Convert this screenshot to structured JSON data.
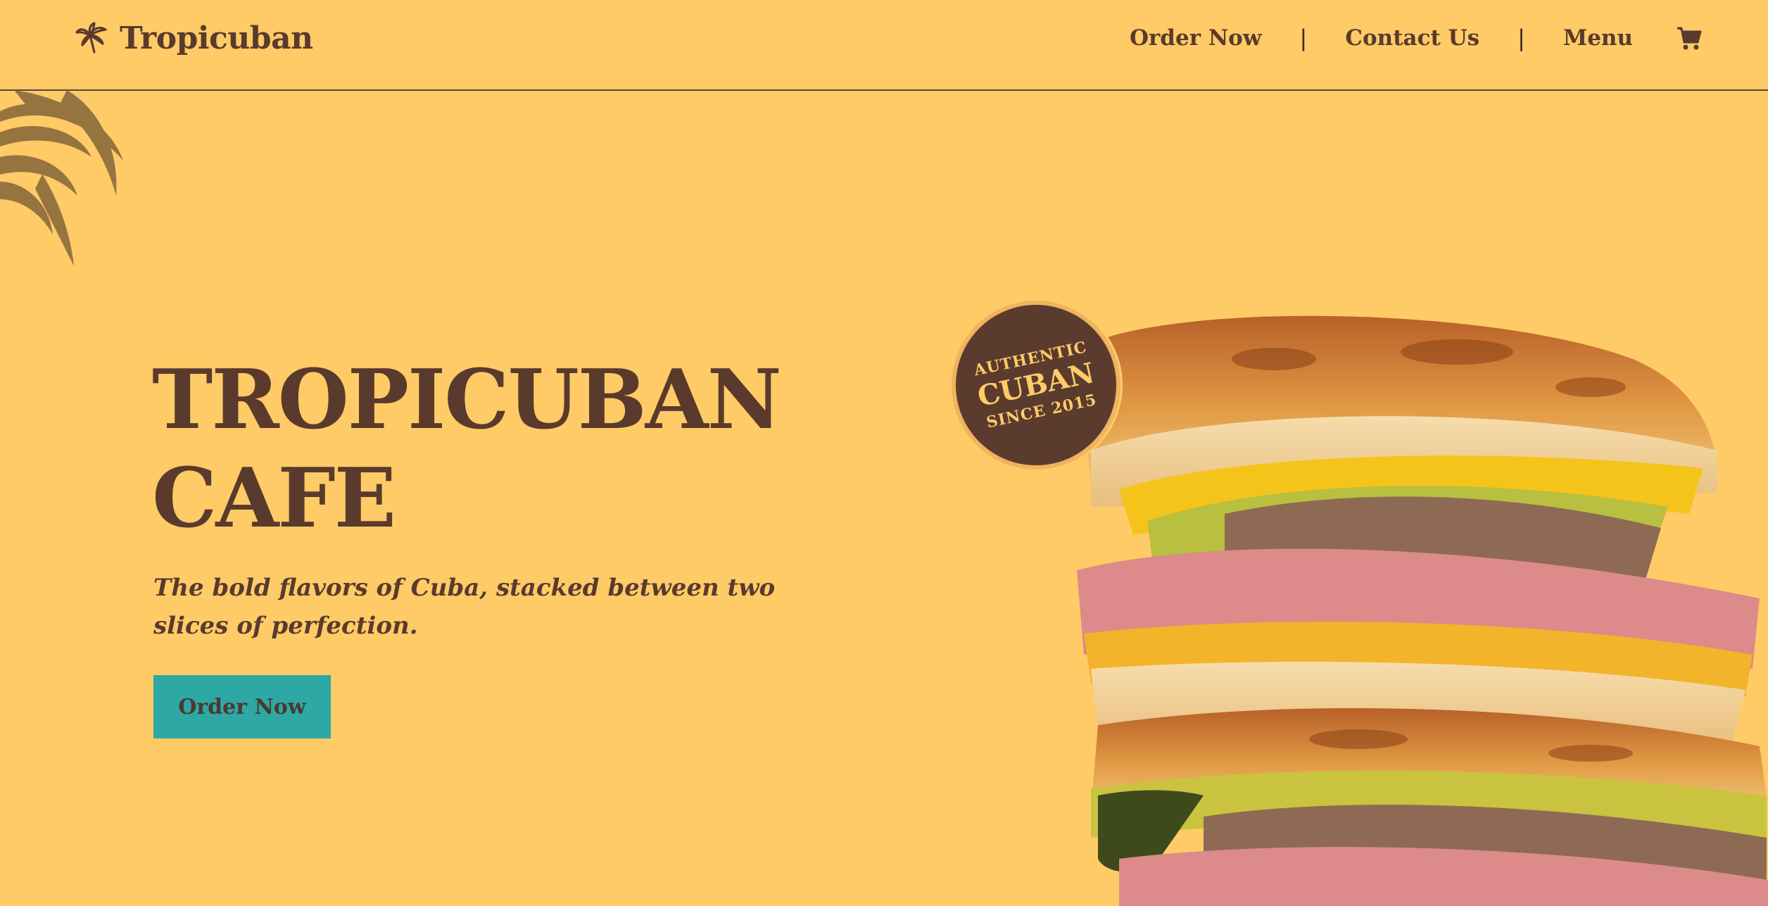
{
  "header": {
    "brand": {
      "name": "Tropicuban",
      "logo_icon": "palm-tree-icon"
    },
    "nav": {
      "links": [
        {
          "label": "Order Now"
        },
        {
          "label": "Contact Us"
        },
        {
          "label": "Menu"
        }
      ],
      "separator": "|",
      "cart_icon": "shopping-cart-icon"
    }
  },
  "hero": {
    "title_line1": "TROPICUBAN",
    "title_line2": "CAFE",
    "subtitle": "The bold flavors of Cuba, stacked between two slices of perfection.",
    "cta_label": "Order Now",
    "decor_icon": "palm-leaf-icon",
    "image_name": "cuban-sandwich-image"
  },
  "badge": {
    "line1": "AUTHENTIC",
    "line2": "CUBAN",
    "line3": "SINCE 2015"
  },
  "colors": {
    "background": "#ffcb67",
    "text": "#5a3a2c",
    "accent": "#2ea8a5",
    "badge": "#5b3b2e"
  }
}
